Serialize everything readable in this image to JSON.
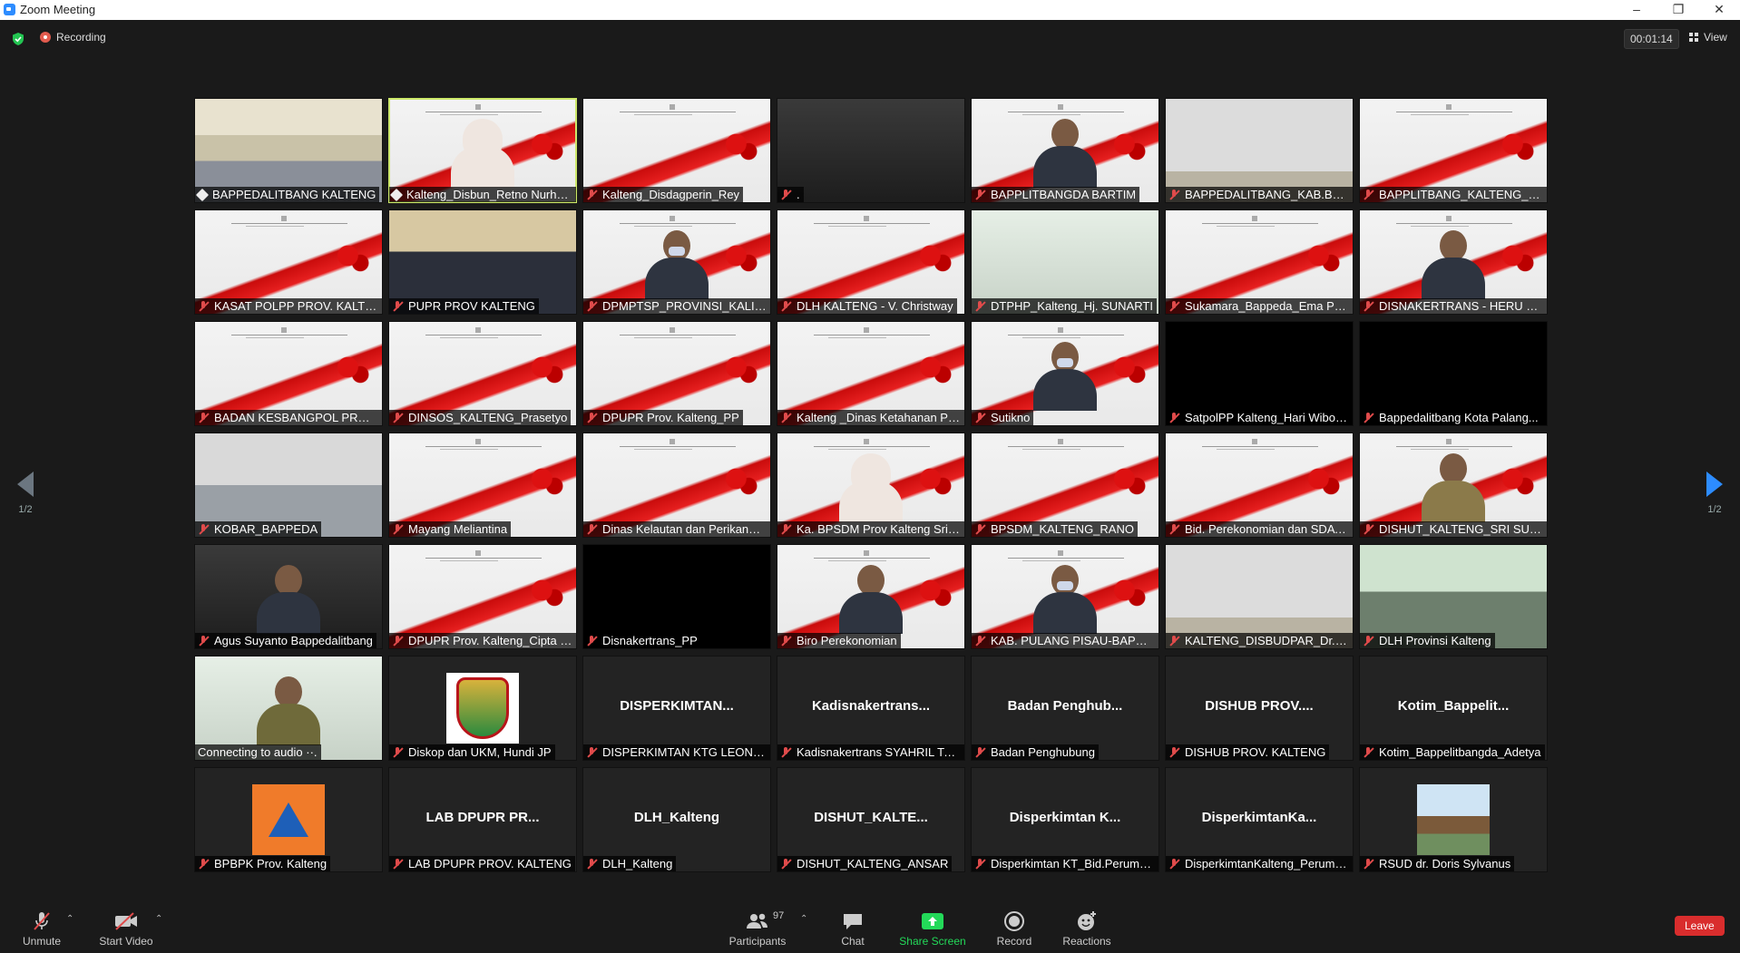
{
  "window": {
    "title": "Zoom Meeting",
    "minimize_icon": "minimize-icon",
    "restore_icon": "restore-icon",
    "close_icon": "close-icon"
  },
  "topbar": {
    "recording_label": "Recording",
    "timer": "00:01:14",
    "view_label": "View"
  },
  "pagination": {
    "left_label": "1/2",
    "right_label": "1/2"
  },
  "tiles": [
    {
      "name": "BAPPEDALITBANG KALTENG",
      "kind": "photo-room",
      "badge": "pin"
    },
    {
      "name": "Kalteng_Disbun_Retno Nurhay...",
      "kind": "slide",
      "person": "hijab",
      "badge": "pin",
      "active": true
    },
    {
      "name": "Kalteng_Disdagperin_Rey",
      "kind": "slide",
      "badge": "mic"
    },
    {
      "name": ".",
      "kind": "photo-dark",
      "badge": "mic"
    },
    {
      "name": "BAPPLITBANGDA BARTIM",
      "kind": "slide",
      "person": "plain",
      "badge": "mic"
    },
    {
      "name": "BAPPEDALITBANG_KAB.BARIT...",
      "kind": "photo-wall",
      "badge": "mic"
    },
    {
      "name": "BAPPLITBANG_KALTENG_FEBRI",
      "kind": "slide",
      "badge": "mic"
    },
    {
      "name": "KASAT POLPP PROV. KALTENG",
      "kind": "slide",
      "badge": "mic"
    },
    {
      "name": "PUPR PROV KALTENG",
      "kind": "photo-office",
      "badge": "mic"
    },
    {
      "name": "DPMPTSP_PROVINSI_KALIMA...",
      "kind": "slide",
      "person": "mask",
      "badge": "mic"
    },
    {
      "name": "DLH KALTENG - V. Christway",
      "kind": "slide",
      "badge": "mic"
    },
    {
      "name": "DTPHP_Kalteng_Hj. SUNARTI",
      "kind": "photo-light",
      "badge": "mic"
    },
    {
      "name": "Sukamara_Bappeda_Ema Purn...",
      "kind": "slide",
      "badge": "mic"
    },
    {
      "name": "DISNAKERTRANS - HERU SETI...",
      "kind": "slide",
      "person": "plain",
      "badge": "mic"
    },
    {
      "name": "BADAN KESBANGPOL PROV K...",
      "kind": "slide",
      "badge": "mic"
    },
    {
      "name": "DINSOS_KALTENG_Prasetyo",
      "kind": "slide",
      "badge": "mic"
    },
    {
      "name": "DPUPR Prov. Kalteng_PP",
      "kind": "slide",
      "badge": "mic"
    },
    {
      "name": "Kalteng _Dinas Ketahanan Pa...",
      "kind": "slide",
      "badge": "mic"
    },
    {
      "name": "Sutikno",
      "kind": "slide",
      "person": "mask",
      "badge": "mic"
    },
    {
      "name": "SatpolPP Kalteng_Hari Wibow...",
      "kind": "photo-blank",
      "badge": "mic"
    },
    {
      "name": "Bappedalitbang  Kota Palang...",
      "kind": "photo-blank",
      "badge": "mic"
    },
    {
      "name": "KOBAR_BAPPEDA",
      "kind": "photo-room2",
      "badge": "mic"
    },
    {
      "name": "Mayang Meliantina",
      "kind": "slide",
      "badge": "mic"
    },
    {
      "name": "Dinas Kelautan dan Perikanan...",
      "kind": "slide",
      "badge": "mic"
    },
    {
      "name": "Ka. BPSDM Prov Kalteng Sri ...",
      "kind": "slide",
      "person": "hijab",
      "badge": "mic"
    },
    {
      "name": "BPSDM_KALTENG_RANO",
      "kind": "slide",
      "badge": "mic"
    },
    {
      "name": "Bid. Perekonomian dan SDA B...",
      "kind": "slide",
      "badge": "mic"
    },
    {
      "name": "DISHUT_KALTENG_SRI SUWA...",
      "kind": "slide",
      "person": "tan",
      "badge": "mic"
    },
    {
      "name": "Agus Suyanto Bappedalitbang",
      "kind": "photo-dark",
      "person": "plain",
      "badge": "mic"
    },
    {
      "name": "DPUPR Prov. Kalteng_Cipta K...",
      "kind": "slide",
      "badge": "mic"
    },
    {
      "name": "Disnakertrans_PP",
      "kind": "photo-blank",
      "badge": "mic"
    },
    {
      "name": "Biro Perekonomian",
      "kind": "slide",
      "person": "plain",
      "badge": "mic"
    },
    {
      "name": "KAB. PULANG PISAU-BAPPED...",
      "kind": "slide",
      "person": "mask",
      "badge": "mic"
    },
    {
      "name": "KALTENG_DISBUDPAR_Dr. GU...",
      "kind": "photo-wall",
      "badge": "mic"
    },
    {
      "name": "DLH Provinsi Kalteng",
      "kind": "photo-green",
      "badge": "mic"
    },
    {
      "name": "Connecting to audio ··.",
      "kind": "photo-light",
      "person": "olive",
      "badge": "none"
    },
    {
      "name": "Diskop dan UKM, Hundi JP",
      "kind": "name-only",
      "avatar": "logo",
      "badge": "mic"
    },
    {
      "name": "DISPERKIMTAN KTG LEONAR...",
      "kind": "name-only",
      "big": "DISPERKIMTAN...",
      "badge": "mic"
    },
    {
      "name": "Kadisnakertrans SYAHRIL TARI...",
      "kind": "name-only",
      "big": "Kadisnakertrans...",
      "badge": "mic"
    },
    {
      "name": "Badan Penghubung",
      "kind": "name-only",
      "big": "Badan  Penghub...",
      "badge": "mic"
    },
    {
      "name": "DISHUB PROV. KALTENG",
      "kind": "name-only",
      "big": "DISHUB  PROV....",
      "badge": "mic"
    },
    {
      "name": "Kotim_Bappelitbangda_Adetya",
      "kind": "name-only",
      "big": "Kotim_Bappelit...",
      "badge": "mic"
    },
    {
      "name": "BPBPK Prov. Kalteng",
      "kind": "name-only",
      "avatar": "bpbd",
      "badge": "mic"
    },
    {
      "name": "LAB DPUPR PROV. KALTENG",
      "kind": "name-only",
      "big": "LAB  DPUPR  PR...",
      "badge": "mic"
    },
    {
      "name": "DLH_Kalteng",
      "kind": "name-only",
      "big": "DLH_Kalteng",
      "badge": "mic"
    },
    {
      "name": "DISHUT_KALTENG_ANSAR",
      "kind": "name-only",
      "big": "DISHUT_KALTE...",
      "badge": "mic"
    },
    {
      "name": "Disperkimtan KT_Bid.Perumah...",
      "kind": "name-only",
      "big": "Disperkimtan  K...",
      "badge": "mic"
    },
    {
      "name": "DisperkimtanKalteng_Peruma...",
      "kind": "name-only",
      "big": "DisperkimtanKa...",
      "badge": "mic"
    },
    {
      "name": "RSUD dr. Doris Sylvanus",
      "kind": "name-only",
      "avatar": "rsud",
      "badge": "mic"
    }
  ],
  "toolbar": {
    "unmute_label": "Unmute",
    "start_video_label": "Start Video",
    "participants_label": "Participants",
    "participants_count": "97",
    "chat_label": "Chat",
    "share_screen_label": "Share Screen",
    "record_label": "Record",
    "reactions_label": "Reactions",
    "leave_label": "Leave",
    "share_color": "#23d959"
  }
}
